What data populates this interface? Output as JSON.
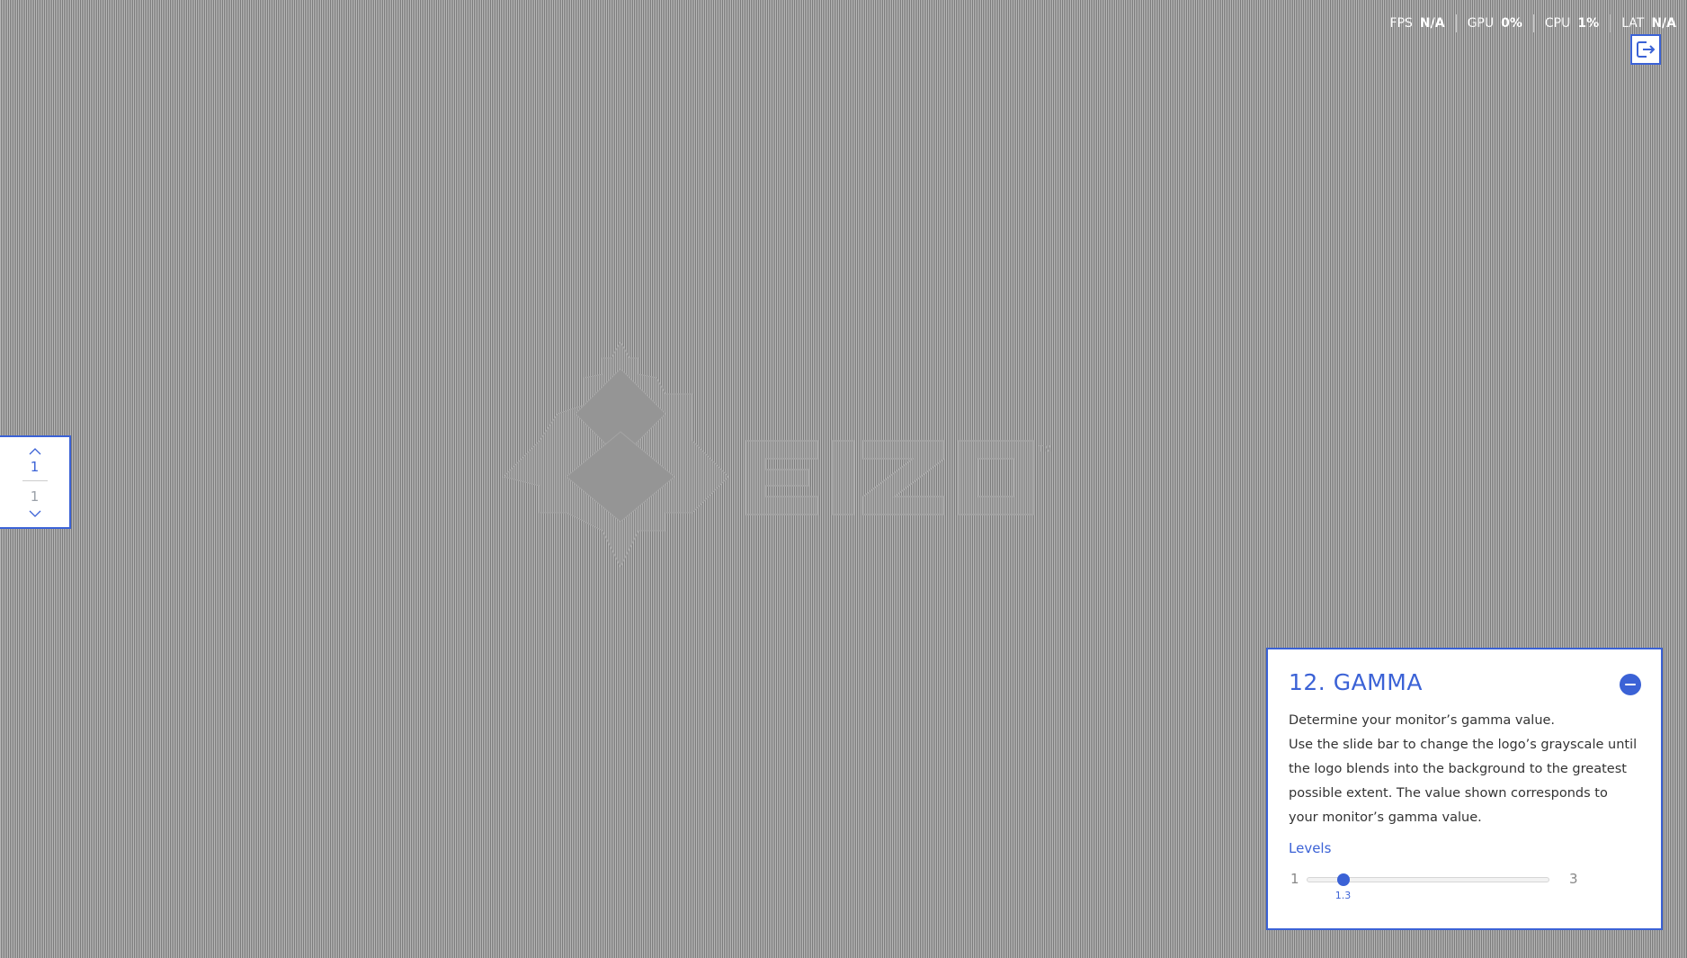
{
  "stats": [
    {
      "label": "FPS",
      "value": "N/A"
    },
    {
      "label": "GPU",
      "value": "0%"
    },
    {
      "label": "CPU",
      "value": "1%"
    },
    {
      "label": "LAT",
      "value": "N/A"
    }
  ],
  "exit_button": {
    "icon": "exit-icon"
  },
  "pager": {
    "current": "1",
    "total": "1",
    "up_icon": "chevron-up-icon",
    "down_icon": "chevron-down-icon"
  },
  "panel": {
    "title": "12. GAMMA",
    "description": [
      "Determine your monitor’s gamma value.",
      "Use the slide bar to change the logo’s grayscale until the logo blends into the background to the greatest possible extent. The value shown corresponds to your monitor’s gamma value."
    ],
    "levels_label": "Levels",
    "slider": {
      "min": "1",
      "max": "3",
      "value": "1.3",
      "value_number": 1.3,
      "min_number": 1,
      "max_number": 3
    }
  },
  "colors": {
    "accent": "#3b62d6",
    "panel_bg": "#ffffff",
    "background_stripe_light": "#b9b9b9",
    "background_stripe_dark": "#7a7a7a"
  }
}
